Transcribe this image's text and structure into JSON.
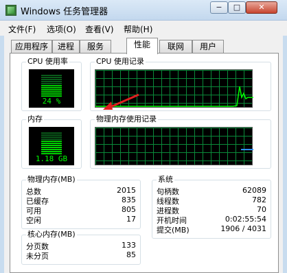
{
  "window": {
    "title": "Windows 任务管理器",
    "min": "−",
    "max": "□",
    "close": "✕"
  },
  "menu": [
    "文件(F)",
    "选项(O)",
    "查看(V)",
    "帮助(H)"
  ],
  "tabs": [
    "应用程序",
    "进程",
    "服务",
    "性能",
    "联网",
    "用户"
  ],
  "active_tab": "性能",
  "cpu_usage": {
    "label": "CPU 使用率",
    "value": "24 %",
    "level": 0.24
  },
  "cpu_history": {
    "label": "CPU 使用记录"
  },
  "memory": {
    "label": "内存",
    "value": "1.18 GB",
    "level": 0.35
  },
  "memory_history": {
    "label": "物理内存使用记录"
  },
  "physical_memory": {
    "title": "物理内存(MB)",
    "rows": [
      {
        "k": "总数",
        "v": "2015"
      },
      {
        "k": "已缓存",
        "v": "835"
      },
      {
        "k": "可用",
        "v": "805"
      },
      {
        "k": "空闲",
        "v": "17"
      }
    ]
  },
  "kernel_memory": {
    "title": "核心内存(MB)",
    "rows": [
      {
        "k": "分页数",
        "v": "133"
      },
      {
        "k": "未分页",
        "v": "85"
      }
    ]
  },
  "system": {
    "title": "系统",
    "rows": [
      {
        "k": "句柄数",
        "v": "62089"
      },
      {
        "k": "线程数",
        "v": "782"
      },
      {
        "k": "进程数",
        "v": "70"
      },
      {
        "k": "开机时间",
        "v": "0:02:55:54"
      },
      {
        "k": "提交(MB)",
        "v": "1906 / 4031"
      }
    ]
  },
  "colors": {
    "graph_line": "#00ff00",
    "memory_line": "#2f8fff",
    "arrow": "#e02020"
  }
}
